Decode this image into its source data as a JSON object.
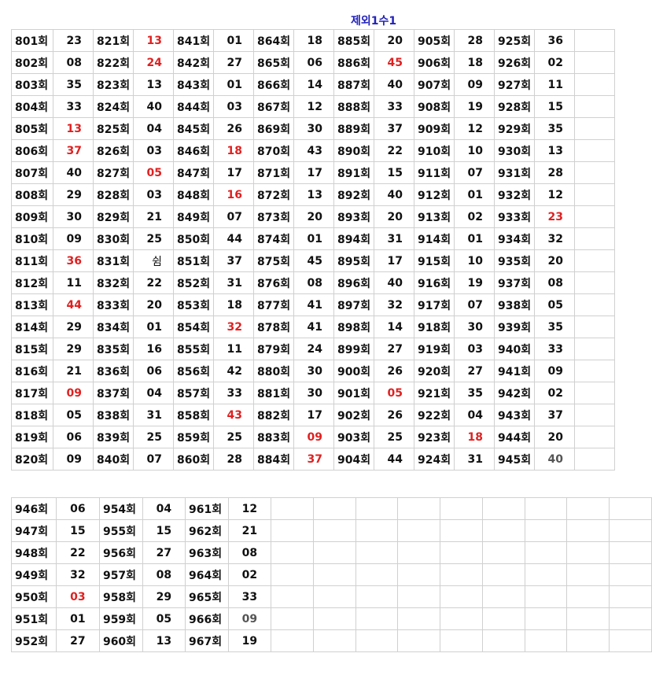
{
  "title": "제외1수1",
  "table1": {
    "rows": [
      [
        [
          "801회",
          "23"
        ],
        [
          "821회",
          "13"
        ],
        [
          "841회",
          "01"
        ],
        [
          "864회",
          "18"
        ],
        [
          "885회",
          "20"
        ],
        [
          "905회",
          "28"
        ],
        [
          "925회",
          "36"
        ]
      ],
      [
        [
          "802회",
          "08"
        ],
        [
          "822회",
          "24"
        ],
        [
          "842회",
          "27"
        ],
        [
          "865회",
          "06"
        ],
        [
          "886회",
          "45"
        ],
        [
          "906회",
          "18"
        ],
        [
          "926회",
          "02"
        ]
      ],
      [
        [
          "803회",
          "35"
        ],
        [
          "823회",
          "13"
        ],
        [
          "843회",
          "01"
        ],
        [
          "866회",
          "14"
        ],
        [
          "887회",
          "40"
        ],
        [
          "907회",
          "09"
        ],
        [
          "927회",
          "11"
        ]
      ],
      [
        [
          "804회",
          "33"
        ],
        [
          "824회",
          "40"
        ],
        [
          "844회",
          "03"
        ],
        [
          "867회",
          "12"
        ],
        [
          "888회",
          "33"
        ],
        [
          "908회",
          "19"
        ],
        [
          "928회",
          "15"
        ]
      ],
      [
        [
          "805회",
          "13"
        ],
        [
          "825회",
          "04"
        ],
        [
          "845회",
          "26"
        ],
        [
          "869회",
          "30"
        ],
        [
          "889회",
          "37"
        ],
        [
          "909회",
          "12"
        ],
        [
          "929회",
          "35"
        ]
      ],
      [
        [
          "806회",
          "37"
        ],
        [
          "826회",
          "03"
        ],
        [
          "846회",
          "18"
        ],
        [
          "870회",
          "43"
        ],
        [
          "890회",
          "22"
        ],
        [
          "910회",
          "10"
        ],
        [
          "930회",
          "13"
        ]
      ],
      [
        [
          "807회",
          "40"
        ],
        [
          "827회",
          "05"
        ],
        [
          "847회",
          "17"
        ],
        [
          "871회",
          "17"
        ],
        [
          "891회",
          "15"
        ],
        [
          "911회",
          "07"
        ],
        [
          "931회",
          "28"
        ]
      ],
      [
        [
          "808회",
          "29"
        ],
        [
          "828회",
          "03"
        ],
        [
          "848회",
          "16"
        ],
        [
          "872회",
          "13"
        ],
        [
          "892회",
          "40"
        ],
        [
          "912회",
          "01"
        ],
        [
          "932회",
          "12"
        ]
      ],
      [
        [
          "809회",
          "30"
        ],
        [
          "829회",
          "21"
        ],
        [
          "849회",
          "07"
        ],
        [
          "873회",
          "20"
        ],
        [
          "893회",
          "20"
        ],
        [
          "913회",
          "02"
        ],
        [
          "933회",
          "23"
        ]
      ],
      [
        [
          "810회",
          "09"
        ],
        [
          "830회",
          "25"
        ],
        [
          "850회",
          "44"
        ],
        [
          "874회",
          "01"
        ],
        [
          "894회",
          "31"
        ],
        [
          "914회",
          "01"
        ],
        [
          "934회",
          "32"
        ]
      ],
      [
        [
          "811회",
          "36"
        ],
        [
          "831회",
          "쉼"
        ],
        [
          "851회",
          "37"
        ],
        [
          "875회",
          "45"
        ],
        [
          "895회",
          "17"
        ],
        [
          "915회",
          "10"
        ],
        [
          "935회",
          "20"
        ]
      ],
      [
        [
          "812회",
          "11"
        ],
        [
          "832회",
          "22"
        ],
        [
          "852회",
          "31"
        ],
        [
          "876회",
          "08"
        ],
        [
          "896회",
          "40"
        ],
        [
          "916회",
          "19"
        ],
        [
          "937회",
          "08"
        ]
      ],
      [
        [
          "813회",
          "44"
        ],
        [
          "833회",
          "20"
        ],
        [
          "853회",
          "18"
        ],
        [
          "877회",
          "41"
        ],
        [
          "897회",
          "32"
        ],
        [
          "917회",
          "07"
        ],
        [
          "938회",
          "05"
        ]
      ],
      [
        [
          "814회",
          "29"
        ],
        [
          "834회",
          "01"
        ],
        [
          "854회",
          "32"
        ],
        [
          "878회",
          "41"
        ],
        [
          "898회",
          "14"
        ],
        [
          "918회",
          "30"
        ],
        [
          "939회",
          "35"
        ]
      ],
      [
        [
          "815회",
          "29"
        ],
        [
          "835회",
          "16"
        ],
        [
          "855회",
          "11"
        ],
        [
          "879회",
          "24"
        ],
        [
          "899회",
          "27"
        ],
        [
          "919회",
          "03"
        ],
        [
          "940회",
          "33"
        ]
      ],
      [
        [
          "816회",
          "21"
        ],
        [
          "836회",
          "06"
        ],
        [
          "856회",
          "42"
        ],
        [
          "880회",
          "30"
        ],
        [
          "900회",
          "26"
        ],
        [
          "920회",
          "27"
        ],
        [
          "941회",
          "09"
        ]
      ],
      [
        [
          "817회",
          "09"
        ],
        [
          "837회",
          "04"
        ],
        [
          "857회",
          "33"
        ],
        [
          "881회",
          "30"
        ],
        [
          "901회",
          "05"
        ],
        [
          "921회",
          "35"
        ],
        [
          "942회",
          "02"
        ]
      ],
      [
        [
          "818회",
          "05"
        ],
        [
          "838회",
          "31"
        ],
        [
          "858회",
          "43"
        ],
        [
          "882회",
          "17"
        ],
        [
          "902회",
          "26"
        ],
        [
          "922회",
          "04"
        ],
        [
          "943회",
          "37"
        ]
      ],
      [
        [
          "819회",
          "06"
        ],
        [
          "839회",
          "25"
        ],
        [
          "859회",
          "25"
        ],
        [
          "883회",
          "09"
        ],
        [
          "903회",
          "25"
        ],
        [
          "923회",
          "18"
        ],
        [
          "944회",
          "20"
        ]
      ],
      [
        [
          "820회",
          "09"
        ],
        [
          "840회",
          "07"
        ],
        [
          "860회",
          "28"
        ],
        [
          "884회",
          "37"
        ],
        [
          "904회",
          "44"
        ],
        [
          "924회",
          "31"
        ],
        [
          "945회",
          "40"
        ]
      ]
    ],
    "red_cells": [
      [
        0,
        1
      ],
      [
        1,
        1
      ],
      [
        1,
        4
      ],
      [
        4,
        0
      ],
      [
        5,
        0
      ],
      [
        5,
        2
      ],
      [
        6,
        1
      ],
      [
        7,
        2
      ],
      [
        8,
        6
      ],
      [
        10,
        0
      ],
      [
        12,
        0
      ],
      [
        13,
        2
      ],
      [
        16,
        0
      ],
      [
        16,
        4
      ],
      [
        17,
        2
      ],
      [
        18,
        3
      ],
      [
        18,
        5
      ],
      [
        19,
        3
      ]
    ],
    "normal_weight_cells": [
      [
        10,
        1
      ]
    ],
    "gray_cells": [
      [
        19,
        6
      ]
    ]
  },
  "table2": {
    "rows": [
      [
        [
          "946회",
          "06"
        ],
        [
          "954회",
          "04"
        ],
        [
          "961회",
          "12"
        ]
      ],
      [
        [
          "947회",
          "15"
        ],
        [
          "955회",
          "15"
        ],
        [
          "962회",
          "21"
        ]
      ],
      [
        [
          "948회",
          "22"
        ],
        [
          "956회",
          "27"
        ],
        [
          "963회",
          "08"
        ]
      ],
      [
        [
          "949회",
          "32"
        ],
        [
          "957회",
          "08"
        ],
        [
          "964회",
          "02"
        ]
      ],
      [
        [
          "950회",
          "03"
        ],
        [
          "958회",
          "29"
        ],
        [
          "965회",
          "33"
        ]
      ],
      [
        [
          "951회",
          "01"
        ],
        [
          "959회",
          "05"
        ],
        [
          "966회",
          "09"
        ]
      ],
      [
        [
          "952회",
          "27"
        ],
        [
          "960회",
          "13"
        ],
        [
          "967회",
          "19"
        ]
      ]
    ],
    "red_cells": [
      [
        4,
        0
      ]
    ],
    "gray_cells": [
      [
        5,
        2
      ]
    ]
  },
  "colors": {
    "title": "#2222bb",
    "highlight_red": "#e02020",
    "text": "#111111",
    "grid": "#d0d0d0"
  }
}
